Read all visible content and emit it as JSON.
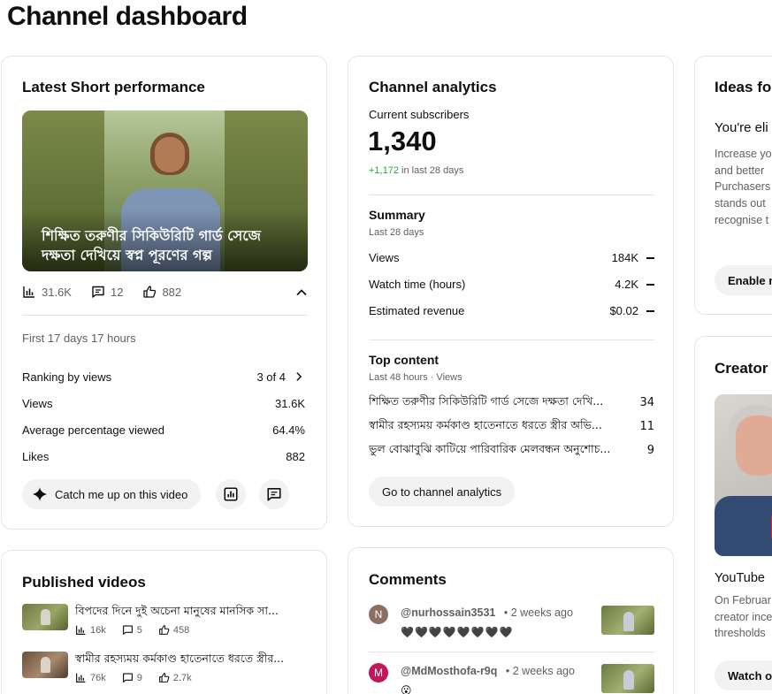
{
  "page": {
    "title": "Channel dashboard"
  },
  "latest_short": {
    "heading": "Latest Short performance",
    "video_title": "শিক্ষিত তরুণীর সিকিউরিটি গার্ড সেজে দক্ষতা দেখিয়ে স্বপ্ন পূরণের গল্প",
    "views": "31.6K",
    "comments": "12",
    "likes": "882",
    "period": "First 17 days 17 hours",
    "metrics": [
      {
        "label": "Ranking by views",
        "value": "3 of 4"
      },
      {
        "label": "Views",
        "value": "31.6K"
      },
      {
        "label": "Average percentage viewed",
        "value": "64.4%"
      },
      {
        "label": "Likes",
        "value": "882"
      }
    ],
    "catch_up_label": "Catch me up on this video"
  },
  "analytics": {
    "heading": "Channel analytics",
    "subs_label": "Current subscribers",
    "subs_value": "1,340",
    "subs_change": "+1,172",
    "subs_change_suffix": "in last 28 days",
    "summary_heading": "Summary",
    "summary_period": "Last 28 days",
    "summary": [
      {
        "label": "Views",
        "value": "184K"
      },
      {
        "label": "Watch time (hours)",
        "value": "4.2K"
      },
      {
        "label": "Estimated revenue",
        "value": "$0.02"
      }
    ],
    "top_heading": "Top content",
    "top_period": "Last 48 hours · Views",
    "top": [
      {
        "title": "শিক্ষিত তরুণীর সিকিউরিটি গার্ড সেজে দক্ষতা দেখি...",
        "views": "34"
      },
      {
        "title": "স্বামীর রহস্যময় কর্মকাণ্ড হাতেনাতে ধরতে স্ত্রীর অভি...",
        "views": "11"
      },
      {
        "title": "ভুল বোঝাবুঝি কাটিয়ে পারিবারিক মেলবন্ধন অনুশোচ...",
        "views": "9"
      }
    ],
    "button_label": "Go to channel analytics"
  },
  "ideas": {
    "heading": "Ideas for",
    "sub_heading": "You're eli",
    "body_lines": [
      "Increase yo",
      "and better",
      "Purchasers",
      "stands out",
      "recognise t"
    ],
    "button_label": "Enable n"
  },
  "creator": {
    "heading": "Creator I",
    "video_title": "YouTube",
    "body_lines": [
      "On Februar",
      "creator ince",
      "thresholds"
    ],
    "button_label": "Watch o"
  },
  "published": {
    "heading": "Published videos",
    "items": [
      {
        "title": "বিপদের দিনে দুই অচেনা মানুষের মানসিক সা...",
        "views": "16k",
        "comments": "5",
        "likes": "458"
      },
      {
        "title": "স্বামীর রহস্যময় কর্মকাণ্ড হাতেনাতে ধরতে স্ত্রীর...",
        "views": "76k",
        "comments": "9",
        "likes": "2.7k"
      }
    ]
  },
  "comments": {
    "heading": "Comments",
    "items": [
      {
        "avatar_letter": "N",
        "avatar_color": "#8d6e63",
        "author": "@nurhossain3531",
        "time": "• 2 weeks ago",
        "text": "🖤🖤🖤🖤🖤🖤🖤🖤"
      },
      {
        "avatar_letter": "M",
        "avatar_color": "#c2185b",
        "author": "@MdMosthofa-r9q",
        "time": "• 2 weeks ago",
        "text": "😮"
      }
    ]
  },
  "colors": {
    "positive": "#2ba640",
    "border": "#e5e5e5",
    "muted": "#606060",
    "pill_bg": "#f2f2f2"
  }
}
